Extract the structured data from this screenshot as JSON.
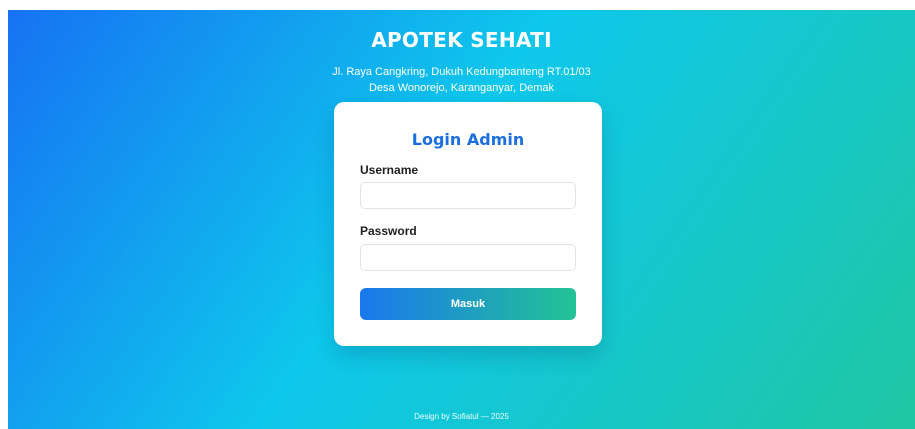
{
  "header": {
    "title": "APOTEK SEHATI",
    "address_line1": "Jl. Raya Cangkring, Dukuh Kedungbanteng RT.01/03",
    "address_line2": "Desa Wonorejo, Karanganyar, Demak"
  },
  "login": {
    "title": "Login Admin",
    "username_label": "Username",
    "username_value": "",
    "password_label": "Password",
    "password_value": "",
    "submit_label": "Masuk"
  },
  "footer": {
    "credit": "Design by Sofiatul — 2025"
  },
  "colors": {
    "gradient_start": "#1672f3",
    "gradient_mid": "#0ec7ec",
    "gradient_end": "#1fc7a3",
    "title_blue": "#1b6fe0",
    "button_start": "#1a78ee",
    "button_end": "#22c394"
  }
}
